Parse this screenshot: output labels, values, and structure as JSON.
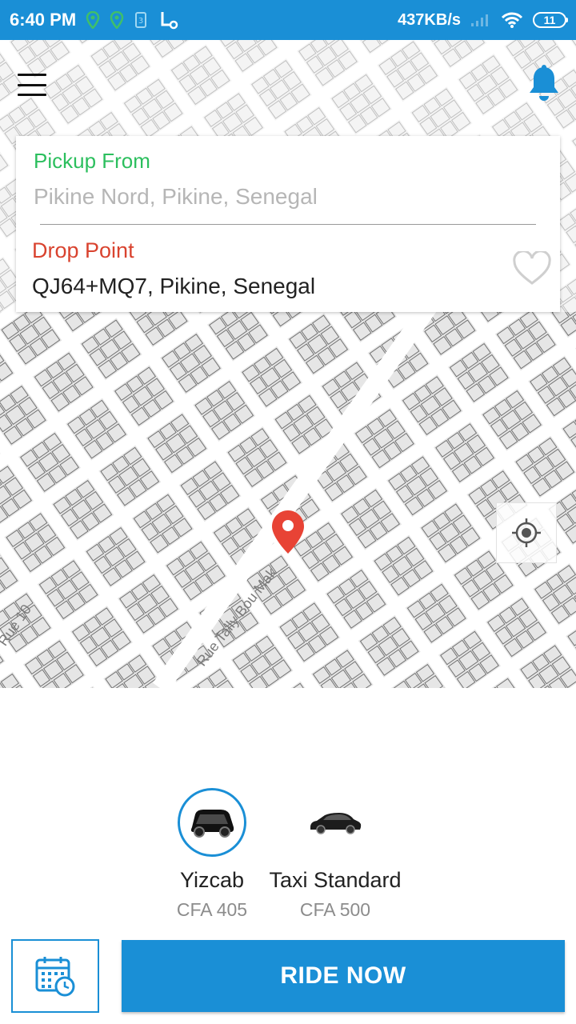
{
  "status_bar": {
    "time": "6:40 PM",
    "network_speed": "437KB/s",
    "battery": "11",
    "icons": [
      "location-pin-icon",
      "location-pin-icon",
      "notification-icon",
      "scooter-app-icon",
      "signal-icon",
      "wifi-icon",
      "battery-icon"
    ]
  },
  "header": {
    "menu_icon": "hamburger-menu-icon",
    "notification_icon": "bell-icon"
  },
  "location_card": {
    "pickup_label": "Pickup From",
    "pickup_value": "Pikine Nord, Pikine, Senegal",
    "drop_label": "Drop Point",
    "drop_value": "QJ64+MQ7, Pikine, Senegal",
    "favorite_icon": "heart-outline-icon"
  },
  "map": {
    "street_labels": [
      "Rue Tally Bou Mak",
      "Rue 10"
    ],
    "locate_icon": "my-location-icon",
    "pin_icon": "map-pin-icon"
  },
  "vehicles": [
    {
      "name": "Yizcab",
      "price": "CFA 405",
      "selected": true,
      "icon": "compact-car-icon"
    },
    {
      "name": "Taxi Standard",
      "price": "CFA 500",
      "selected": false,
      "icon": "sedan-car-icon"
    }
  ],
  "actions": {
    "schedule_icon": "calendar-clock-icon",
    "ride_now_label": "RIDE NOW"
  },
  "colors": {
    "primary": "#1a8fd6",
    "pickup_green": "#2cbf5e",
    "drop_red": "#d9432f",
    "pin_red": "#e84335"
  }
}
